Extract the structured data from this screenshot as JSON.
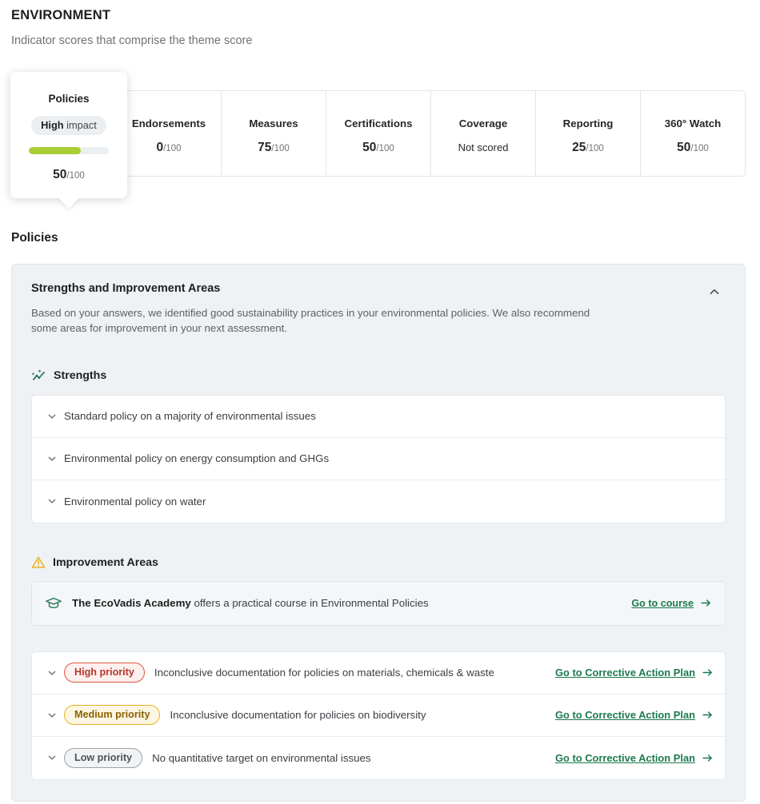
{
  "header": {
    "title": "ENVIRONMENT",
    "subtitle": "Indicator scores that comprise the theme score"
  },
  "tooltip": {
    "title": "Policies",
    "impact_level": "High",
    "impact_suffix": " impact",
    "score": "50",
    "score_denominator": "/100",
    "bar_fill_percent": 65,
    "bar_color": "#a8cf38"
  },
  "metrics": [
    {
      "label": "Policies",
      "value": "50",
      "denominator": "/100",
      "scored": true
    },
    {
      "label": "Endorsements",
      "value": "0",
      "denominator": "/100",
      "scored": true
    },
    {
      "label": "Measures",
      "value": "75",
      "denominator": "/100",
      "scored": true
    },
    {
      "label": "Certifications",
      "value": "50",
      "denominator": "/100",
      "scored": true
    },
    {
      "label": "Coverage",
      "value": "Not scored",
      "denominator": "",
      "scored": false
    },
    {
      "label": "Reporting",
      "value": "25",
      "denominator": "/100",
      "scored": true
    },
    {
      "label": "360° Watch",
      "value": "50",
      "denominator": "/100",
      "scored": true
    }
  ],
  "section": {
    "heading": "Policies"
  },
  "panel": {
    "title": "Strengths and Improvement Areas",
    "description": "Based on your answers, we identified good sustainability practices in your environmental policies. We also recommend some areas for improvement in your next assessment.",
    "collapse_icon": "chevron-up-icon"
  },
  "strengths": {
    "icon": "trend-up-sparkle-icon",
    "heading": "Strengths",
    "items": [
      {
        "text": "Standard policy on a majority of environmental issues"
      },
      {
        "text": "Environmental policy on energy consumption and GHGs"
      },
      {
        "text": "Environmental policy on water"
      }
    ]
  },
  "improvement": {
    "icon": "warning-triangle-icon",
    "heading": "Improvement Areas",
    "academy": {
      "icon": "graduation-cap-icon",
      "brand": "The EcoVadis Academy",
      "text": " offers a practical course in Environmental Policies",
      "link_label": "Go to course",
      "link_icon": "arrow-right-icon"
    },
    "items": [
      {
        "priority": "High priority",
        "priority_level": "high",
        "text": "Inconclusive documentation for policies on materials, chemicals & waste",
        "link_label": "Go to Corrective Action Plan"
      },
      {
        "priority": "Medium priority",
        "priority_level": "medium",
        "text": "Inconclusive documentation for policies on biodiversity",
        "link_label": "Go to Corrective Action Plan"
      },
      {
        "priority": "Low priority",
        "priority_level": "low",
        "text": "No quantitative target on environmental issues",
        "link_label": "Go to Corrective Action Plan"
      }
    ]
  },
  "colors": {
    "accent_green": "#1d7a4f",
    "bar_green": "#a8cf38",
    "high_priority": "#d9563f",
    "medium_priority": "#eaaf1c",
    "low_priority": "#9ba2a8",
    "panel_bg": "#eef2f5"
  }
}
